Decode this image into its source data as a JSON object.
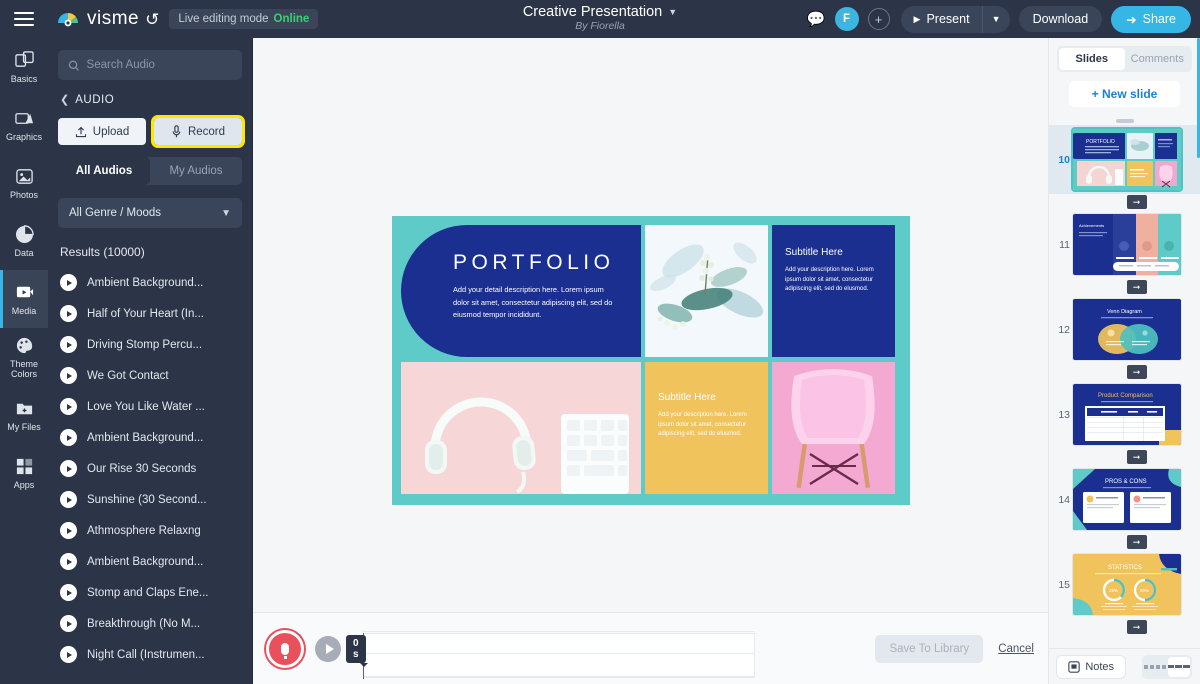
{
  "app": {
    "brand": "visme",
    "menu_icon": "hamburger-icon",
    "undo_icon": "undo-icon",
    "live_mode_label": "Live editing mode",
    "live_status": "Online"
  },
  "header": {
    "doc_title": "Creative Presentation",
    "doc_author": "By Fiorella",
    "comment_icon": "comment-icon",
    "avatar_initial": "F",
    "add_collaborator": "+",
    "present_label": "Present",
    "download_label": "Download",
    "share_label": "Share",
    "accent_blue": "#35b6e5",
    "topbar_bg": "#2c3547"
  },
  "rail": {
    "items": [
      {
        "label": "Basics",
        "icon": "basics-icon",
        "active": false
      },
      {
        "label": "Graphics",
        "icon": "graphics-icon",
        "active": false
      },
      {
        "label": "Photos",
        "icon": "photos-icon",
        "active": false
      },
      {
        "label": "Data",
        "icon": "data-icon",
        "active": false
      },
      {
        "label": "Media",
        "icon": "media-icon",
        "active": true
      },
      {
        "label": "Theme Colors",
        "icon": "palette-icon",
        "active": false
      },
      {
        "label": "My Files",
        "icon": "my-files-icon",
        "active": false
      },
      {
        "label": "Apps",
        "icon": "apps-icon",
        "active": false
      }
    ]
  },
  "audio_panel": {
    "search_placeholder": "Search Audio",
    "search_value": "",
    "back_label": "AUDIO",
    "upload_label": "Upload",
    "record_label": "Record",
    "record_highlight_color": "#ffe800",
    "tabs": [
      {
        "label": "All Audios",
        "active": true
      },
      {
        "label": "My Audios",
        "active": false
      }
    ],
    "genre_select": "All Genre / Moods",
    "results_label": "Results (10000)",
    "tracks": [
      {
        "name": "Ambient Background..."
      },
      {
        "name": "Half of Your Heart (In..."
      },
      {
        "name": "Driving Stomp Percu..."
      },
      {
        "name": "We Got Contact"
      },
      {
        "name": "Love You Like Water ..."
      },
      {
        "name": "Ambient Background..."
      },
      {
        "name": "Our Rise 30 Seconds"
      },
      {
        "name": "Sunshine (30 Second..."
      },
      {
        "name": "Athmosphere Relaxng"
      },
      {
        "name": "Ambient Background..."
      },
      {
        "name": "Stomp and Claps Ene..."
      },
      {
        "name": "Breakthrough (No M..."
      },
      {
        "name": "Night Call (Instrumen..."
      }
    ]
  },
  "slide": {
    "background": "#5ecbc8",
    "portfolio_title": "PORTFOLIO",
    "portfolio_body": "Add your detail description here. Lorem ipsum dolor sit amet, consectetur adipiscing elit, sed do eiusmod tempor incididunt.",
    "subtitle_1": "Subtitle Here",
    "subtitle_1_body": "Add your description here. Lorem ipsum dolor sit amet, consectetur adipiscing elit, sed do elusmod.",
    "subtitle_2": "Subtitle Here",
    "subtitle_2_body": "Add your description here. Lorem ipsum dolor sit amet, consectetur adipiscing elit, sed do elusmod.",
    "image_floral": "floral-watercolor-image",
    "image_headphones": "headphones-photo",
    "image_chair": "pink-chair-photo",
    "navy": "#1a2f8f",
    "yellow": "#f0c35d",
    "pink": "#f0a8cd",
    "blush": "#f5d4d4"
  },
  "recording": {
    "mic_icon": "microphone-icon",
    "play_icon": "play-icon",
    "time_label": "0 s",
    "save_label": "Save To Library",
    "cancel_label": "Cancel"
  },
  "slides_panel": {
    "tabs": [
      {
        "label": "Slides",
        "active": true
      },
      {
        "label": "Comments",
        "active": false
      }
    ],
    "new_slide_label": "+ New slide",
    "thumbnails": [
      {
        "number": "10",
        "title": "PORTFOLIO",
        "selected": true
      },
      {
        "number": "11",
        "title": "Achievements",
        "selected": false
      },
      {
        "number": "12",
        "title": "Venn Diagram",
        "selected": false
      },
      {
        "number": "13",
        "title": "Product Comparison",
        "selected": false
      },
      {
        "number": "14",
        "title": "PROS & CONS",
        "selected": false
      },
      {
        "number": "15",
        "title": "STATISTICS",
        "selected": false
      }
    ],
    "transition_icon": "transition-icon",
    "notes_label": "Notes",
    "notes_icon": "notes-icon",
    "grid_view_icon": "grid-view-icon",
    "list_view_icon": "list-view-icon"
  }
}
